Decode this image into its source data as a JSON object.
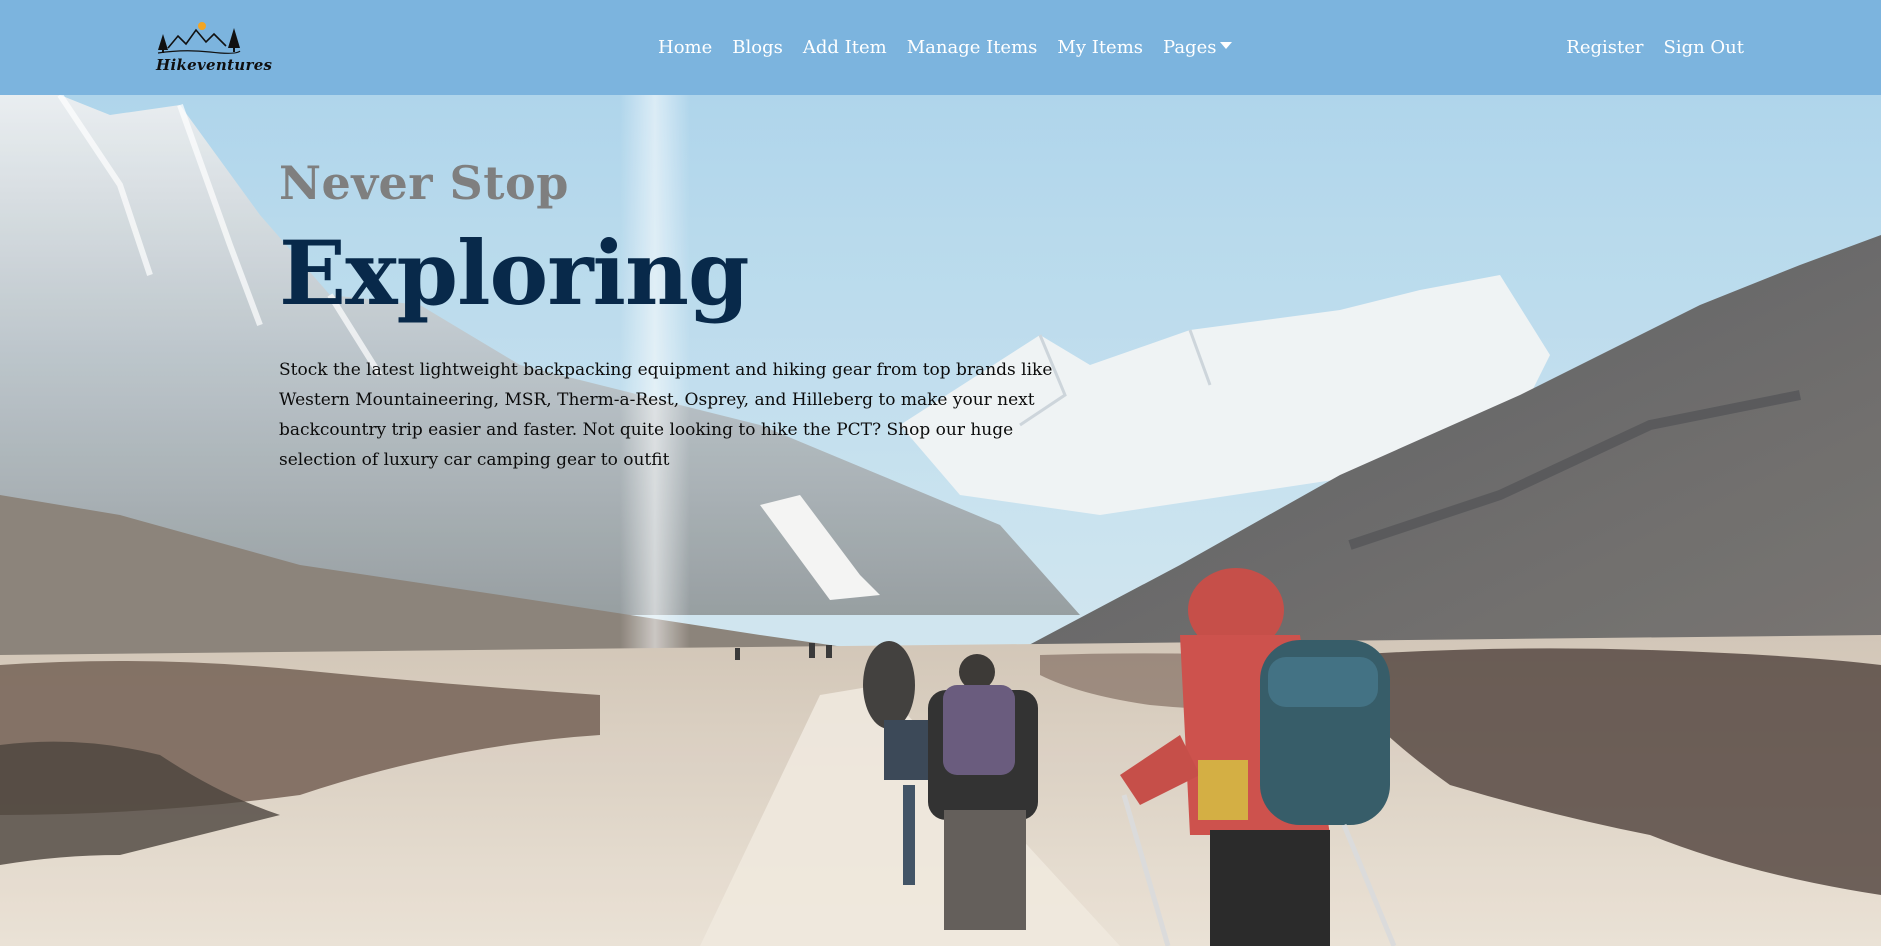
{
  "brand": {
    "name": "Hikeventures",
    "logo_icon": "mountain-logo-icon"
  },
  "nav": {
    "items": [
      {
        "label": "Home"
      },
      {
        "label": "Blogs"
      },
      {
        "label": "Add Item"
      },
      {
        "label": "Manage Items"
      },
      {
        "label": "My Items"
      },
      {
        "label": "Pages"
      }
    ],
    "right": [
      {
        "label": "Register"
      },
      {
        "label": "Sign Out"
      }
    ]
  },
  "hero": {
    "eyebrow": "Never Stop",
    "headline": "Exploring",
    "text": "Stock the latest lightweight backpacking equipment and hiking gear from top brands like Western Mountaineering, MSR, Therm-a-Rest, Osprey, and Hilleberg to make your next backcountry trip easier and faster. Not quite looking to hike the PCT? Shop our huge selection of luxury car camping gear to outfit"
  },
  "colors": {
    "navbar_bg": "#7cb4de",
    "headline": "#08294a",
    "eyebrow": "#7f7f7f"
  }
}
